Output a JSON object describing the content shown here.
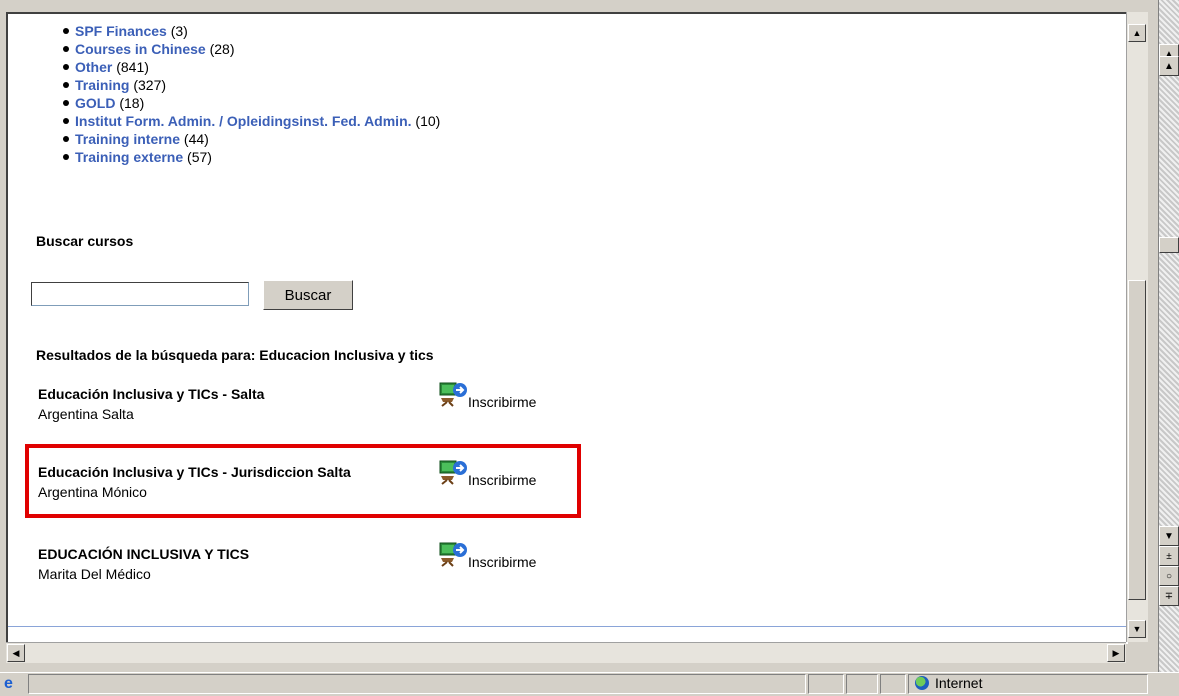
{
  "categories": [
    {
      "label": "SPF Finances",
      "count": "(3)"
    },
    {
      "label": "Courses in Chinese",
      "count": "(28)"
    },
    {
      "label": "Other",
      "count": "(841)"
    },
    {
      "label": "Training",
      "count": "(327)"
    },
    {
      "label": "GOLD",
      "count": "(18)"
    },
    {
      "label": "Institut Form. Admin. / Opleidingsinst. Fed. Admin.",
      "count": "(10)"
    },
    {
      "label": "Training interne",
      "count": "(44)"
    },
    {
      "label": "Training externe",
      "count": "(57)"
    }
  ],
  "search": {
    "title": "Buscar cursos",
    "value": "",
    "button_label": "Buscar"
  },
  "results": {
    "heading": "Resultados de la búsqueda para: Educacion Inclusiva y tics",
    "items": [
      {
        "title": "Educación Inclusiva y TICs - Salta",
        "subtitle": "Argentina Salta",
        "enroll_label": "Inscribirme"
      },
      {
        "title": "Educación Inclusiva y TICs - Jurisdiccion Salta",
        "subtitle": "Argentina Mónico",
        "enroll_label": "Inscribirme"
      },
      {
        "title": "EDUCACIÓN INCLUSIVA Y TICS",
        "subtitle": "Marita Del Médico",
        "enroll_label": "Inscribirme"
      }
    ]
  },
  "statusbar": {
    "zone_label": "Internet"
  },
  "colors": {
    "link": "#3b5fb7",
    "highlight": "#e00000"
  }
}
